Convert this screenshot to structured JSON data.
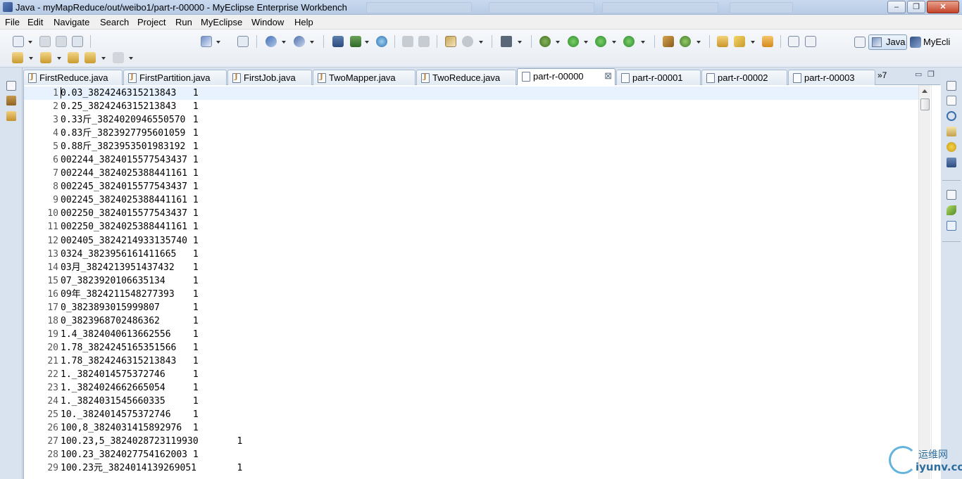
{
  "window": {
    "title": "Java - myMapReduce/out/weibo1/part-r-00000 - MyEclipse Enterprise Workbench",
    "min_label": "–",
    "max_label": "❐",
    "close_label": "✕"
  },
  "menu": [
    "File",
    "Edit",
    "Navigate",
    "Search",
    "Project",
    "Run",
    "MyEclipse",
    "Window",
    "Help"
  ],
  "perspectives": {
    "active": "Java",
    "other": "MyEcli"
  },
  "tabs": [
    {
      "label": "FirstReduce.java",
      "kind": "java"
    },
    {
      "label": "FirstPartition.java",
      "kind": "java"
    },
    {
      "label": "FirstJob.java",
      "kind": "java"
    },
    {
      "label": "TwoMapper.java",
      "kind": "java"
    },
    {
      "label": "TwoReduce.java",
      "kind": "java"
    },
    {
      "label": "part-r-00000",
      "kind": "file",
      "active": true
    },
    {
      "label": "part-r-00001",
      "kind": "file"
    },
    {
      "label": "part-r-00002",
      "kind": "file"
    },
    {
      "label": "part-r-00003",
      "kind": "file"
    }
  ],
  "tab_overflow": "»7",
  "editor": {
    "lines": [
      {
        "n": "1",
        "text": "0.03_3824246315213843\t1"
      },
      {
        "n": "2",
        "text": "0.25_3824246315213843\t1"
      },
      {
        "n": "3",
        "text": "0.33斤_3824020946550570\t1"
      },
      {
        "n": "4",
        "text": "0.83斤_3823927795601059\t1"
      },
      {
        "n": "5",
        "text": "0.88斤_3823953501983192\t1"
      },
      {
        "n": "6",
        "text": "002244_3824015577543437\t1"
      },
      {
        "n": "7",
        "text": "002244_3824025388441161\t1"
      },
      {
        "n": "8",
        "text": "002245_3824015577543437\t1"
      },
      {
        "n": "9",
        "text": "002245_3824025388441161\t1"
      },
      {
        "n": "10",
        "text": "002250_3824015577543437\t1"
      },
      {
        "n": "11",
        "text": "002250_3824025388441161\t1"
      },
      {
        "n": "12",
        "text": "002405_3824214933135740\t1"
      },
      {
        "n": "13",
        "text": "0324_3823956161411665\t1"
      },
      {
        "n": "14",
        "text": "03月_3824213951437432\t1"
      },
      {
        "n": "15",
        "text": "07_3823920106635134\t1"
      },
      {
        "n": "16",
        "text": "09年_3824211548277393\t1"
      },
      {
        "n": "17",
        "text": "0_3823893015999807\t1"
      },
      {
        "n": "18",
        "text": "0_3823968702486362\t1"
      },
      {
        "n": "19",
        "text": "1.4_3824040613662556\t1"
      },
      {
        "n": "20",
        "text": "1.78_3824245165351566\t1"
      },
      {
        "n": "21",
        "text": "1.78_3824246315213843\t1"
      },
      {
        "n": "22",
        "text": "1._3824014575372746\t1"
      },
      {
        "n": "23",
        "text": "1._3824024662665054\t1"
      },
      {
        "n": "24",
        "text": "1._3824031545660335\t1"
      },
      {
        "n": "25",
        "text": "10._3824014575372746\t1"
      },
      {
        "n": "26",
        "text": "100,8_3824031415892976\t1"
      },
      {
        "n": "27",
        "text": "100.23,5_3824028723119930\t1"
      },
      {
        "n": "28",
        "text": "100.23_3824027754162003\t1"
      },
      {
        "n": "29",
        "text": "100.23元_3824014139269051\t1"
      }
    ]
  },
  "watermark": {
    "cn": "运维网",
    "en": "iyunv.com"
  }
}
